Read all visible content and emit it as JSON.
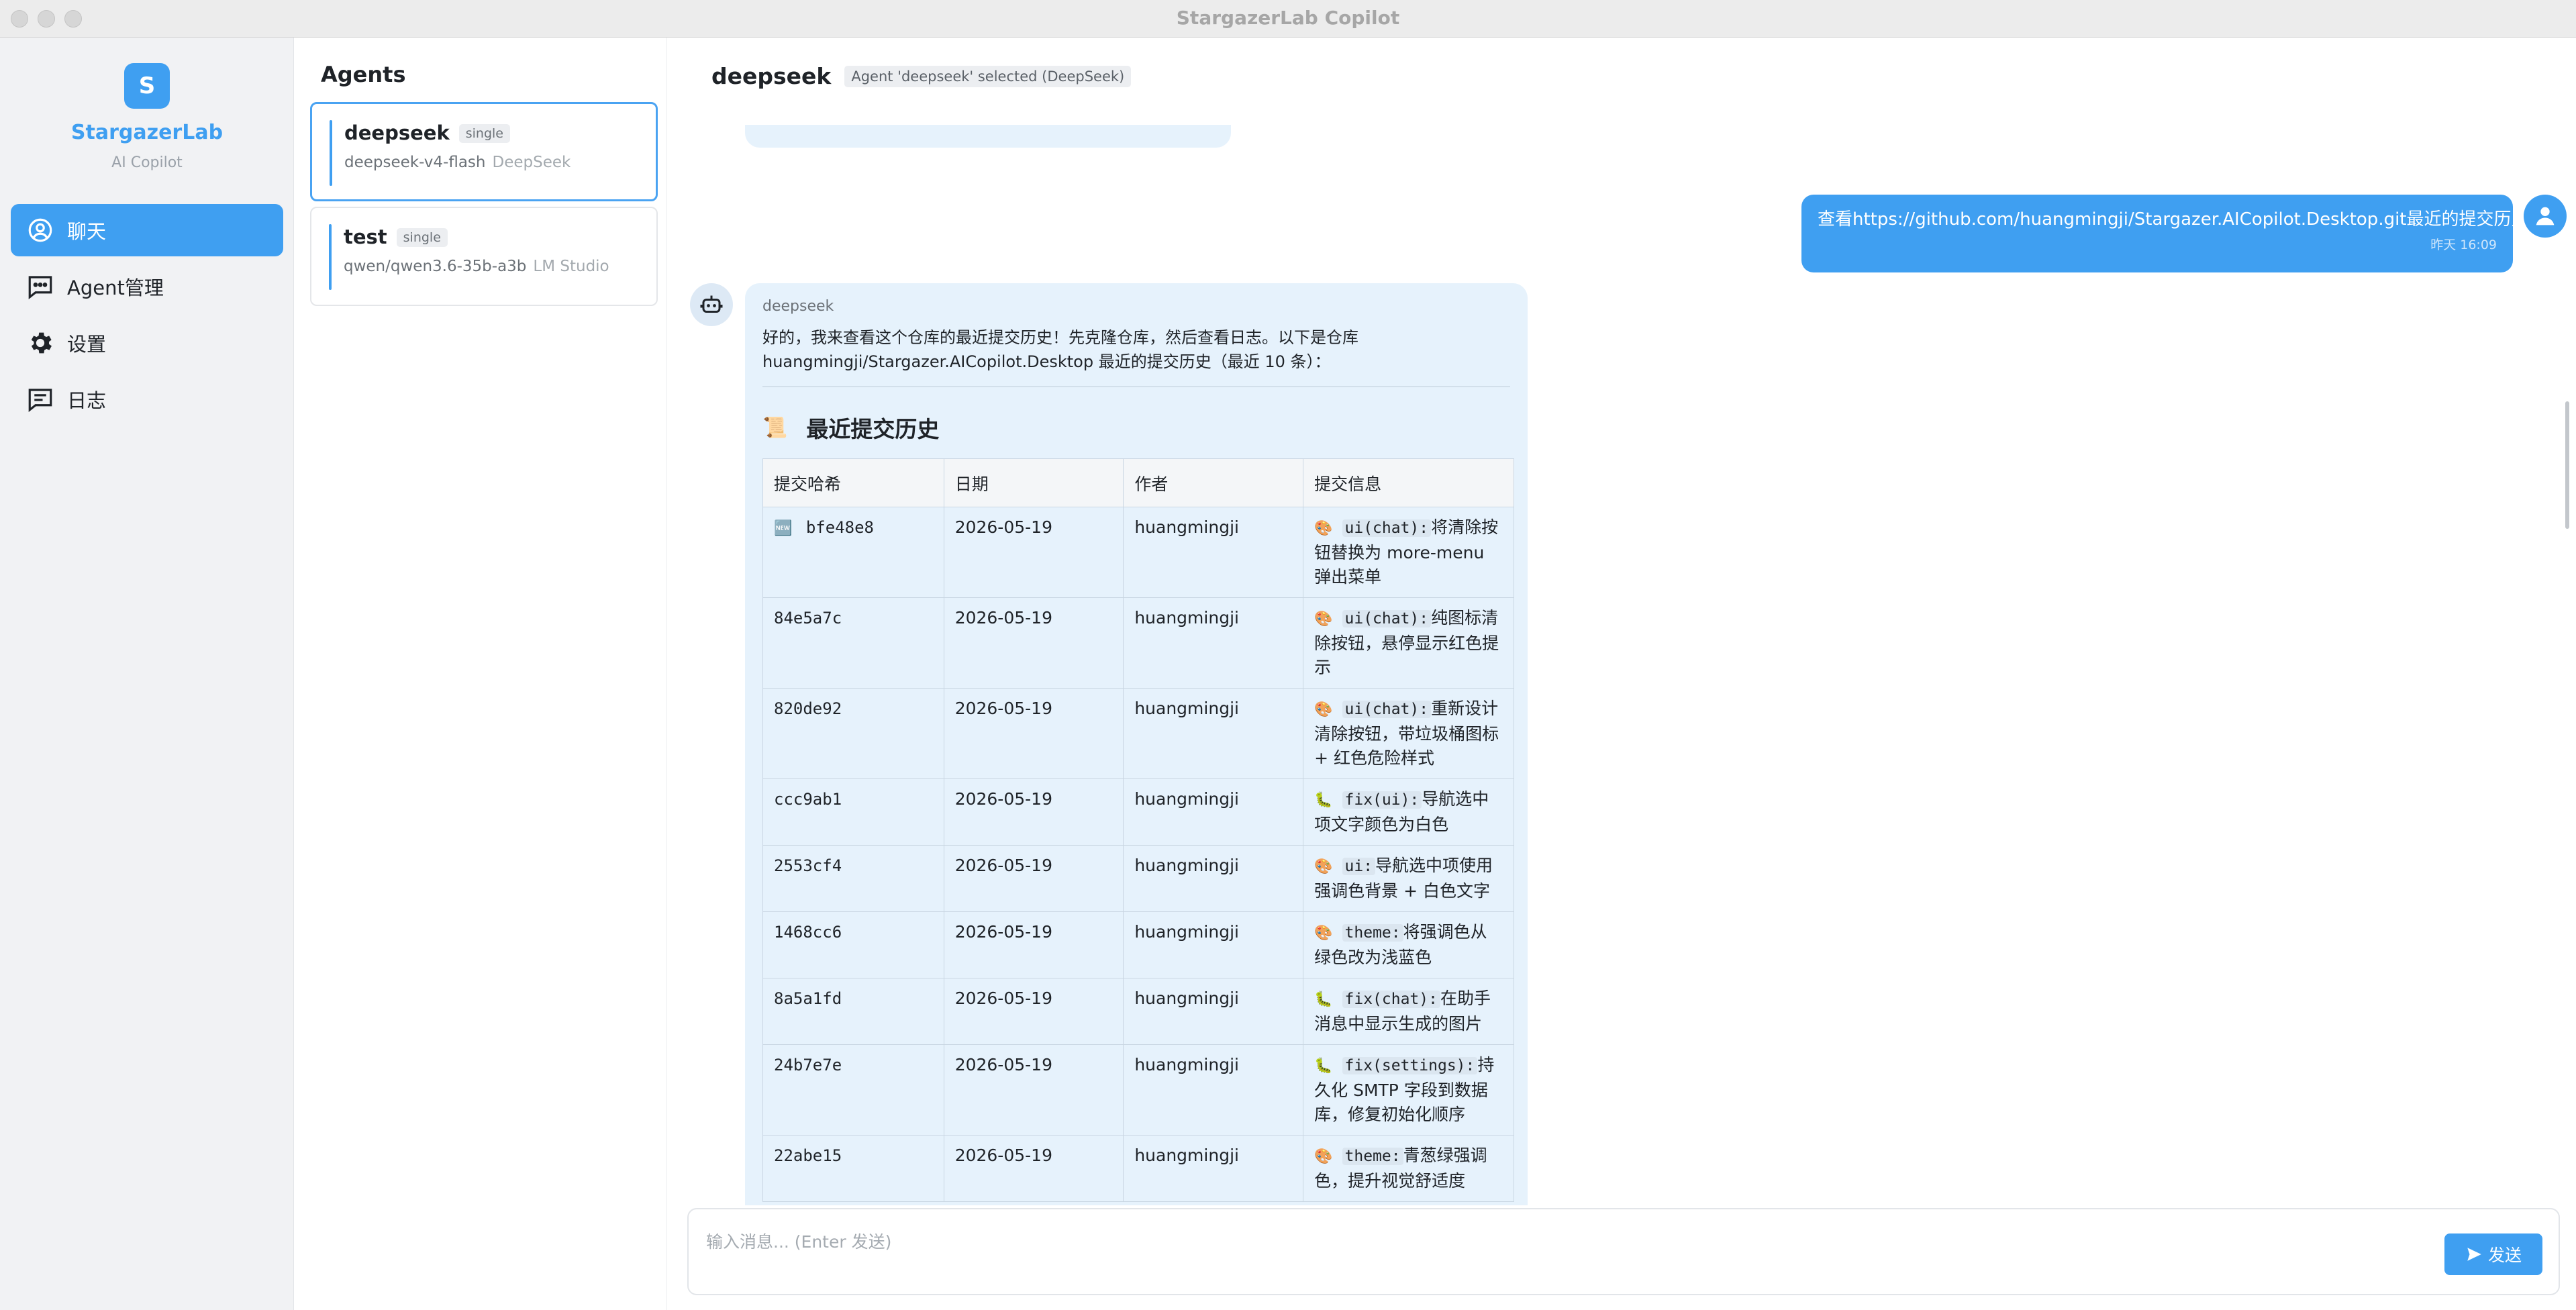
{
  "window": {
    "title": "StargazerLab Copilot"
  },
  "sidebar": {
    "logo_letter": "S",
    "brand": "StargazerLab",
    "subtitle": "AI Copilot",
    "items": [
      {
        "label": "聊天",
        "icon": "chat-bubble-user-icon",
        "active": true
      },
      {
        "label": "Agent管理",
        "icon": "message-dots-icon",
        "active": false
      },
      {
        "label": "设置",
        "icon": "gear-icon",
        "active": false
      },
      {
        "label": "日志",
        "icon": "log-list-icon",
        "active": false
      }
    ]
  },
  "agents_panel": {
    "title": "Agents",
    "agents": [
      {
        "name": "deepseek",
        "badge": "single",
        "model": "deepseek-v4-flash",
        "provider": "DeepSeek",
        "selected": true
      },
      {
        "name": "test",
        "badge": "single",
        "model": "qwen/qwen3.6-35b-a3b",
        "provider": "LM Studio",
        "selected": false
      }
    ]
  },
  "chat": {
    "title": "deepseek",
    "status": "Agent 'deepseek' selected (DeepSeek)",
    "user_message": {
      "text": "查看https://github.com/huangmingji/Stargazer.AICopilot.Desktop.git最近的提交历史",
      "time": "昨天 16:09"
    },
    "bot_message": {
      "sender": "deepseek",
      "intro": "好的，我来查看这个仓库的最近提交历史！先克隆仓库，然后查看日志。以下是仓库 huangmingji/Stargazer.AICopilot.Desktop 最近的提交历史（最近 10 条）：",
      "heading_icon": "📜",
      "heading": "最近提交历史",
      "table": {
        "headers": [
          "提交哈希",
          "日期",
          "作者",
          "提交信息"
        ],
        "rows": [
          {
            "badge": "🆕",
            "hash": "bfe48e8",
            "date": "2026-05-19",
            "author": "huangmingji",
            "icon": "🎨",
            "code": "ui(chat):",
            "text": "将清除按钮替换为 more-menu 弹出菜单"
          },
          {
            "badge": "",
            "hash": "84e5a7c",
            "date": "2026-05-19",
            "author": "huangmingji",
            "icon": "🎨",
            "code": "ui(chat):",
            "text": "纯图标清除按钮，悬停显示红色提示"
          },
          {
            "badge": "",
            "hash": "820de92",
            "date": "2026-05-19",
            "author": "huangmingji",
            "icon": "🎨",
            "code": "ui(chat):",
            "text": "重新设计清除按钮，带垃圾桶图标 + 红色危险样式"
          },
          {
            "badge": "",
            "hash": "ccc9ab1",
            "date": "2026-05-19",
            "author": "huangmingji",
            "icon": "🐛",
            "code": "fix(ui):",
            "text": "导航选中项文字颜色为白色"
          },
          {
            "badge": "",
            "hash": "2553cf4",
            "date": "2026-05-19",
            "author": "huangmingji",
            "icon": "🎨",
            "code": "ui:",
            "text": "导航选中项使用强调色背景 + 白色文字"
          },
          {
            "badge": "",
            "hash": "1468cc6",
            "date": "2026-05-19",
            "author": "huangmingji",
            "icon": "🎨",
            "code": "theme:",
            "text": "将强调色从绿色改为浅蓝色"
          },
          {
            "badge": "",
            "hash": "8a5a1fd",
            "date": "2026-05-19",
            "author": "huangmingji",
            "icon": "🐛",
            "code": "fix(chat):",
            "text": "在助手消息中显示生成的图片"
          },
          {
            "badge": "",
            "hash": "24b7e7e",
            "date": "2026-05-19",
            "author": "huangmingji",
            "icon": "🐛",
            "code": "fix(settings):",
            "text": "持久化 SMTP 字段到数据库，修复初始化顺序"
          },
          {
            "badge": "",
            "hash": "22abe15",
            "date": "2026-05-19",
            "author": "huangmingji",
            "icon": "🎨",
            "code": "theme:",
            "text": "青葱绿强调色，提升视觉舒适度"
          }
        ]
      }
    },
    "input": {
      "placeholder": "输入消息... (Enter 发送)",
      "value": ""
    },
    "send_label": "发送"
  },
  "colors": {
    "accent": "#3f9ff1",
    "bot_bubble": "#e6f2fc",
    "sidebar_bg": "#f1f2f4"
  }
}
